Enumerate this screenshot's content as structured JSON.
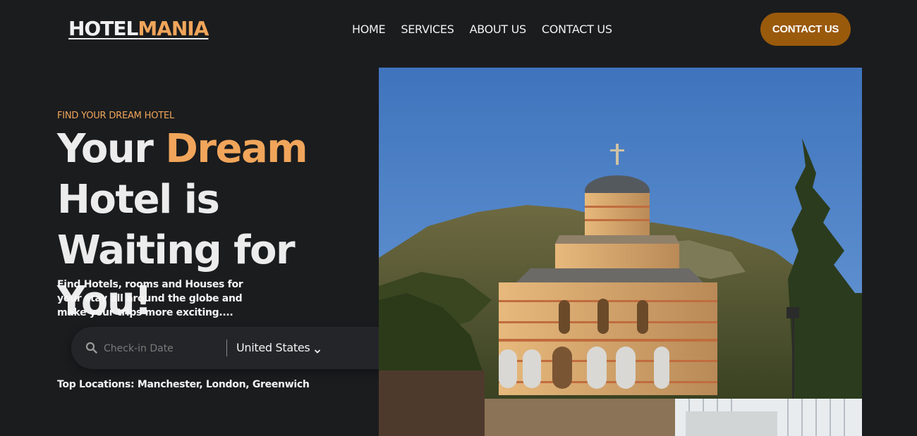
{
  "brand": {
    "part1": "HOTEL",
    "part2": "MANIA"
  },
  "nav": {
    "items": [
      "HOME",
      "SERVICES",
      "ABOUT US",
      "CONTACT US"
    ]
  },
  "header": {
    "cta_label": "CONTACT US"
  },
  "hero": {
    "eyebrow": "FIND YOUR DREAM HOTEL",
    "headline_part1": "Your ",
    "headline_accent": "Dream",
    "headline_part2": "Hotel is Waiting for You!",
    "description": "Find Hotels, rooms and Houses for your stay all around the globe and make your trips more exciting....",
    "top_locations": "Top Locations: Manchester, London, Greenwich"
  },
  "search": {
    "date_placeholder": "Check-in Date",
    "date_value": "",
    "country_selected": "United States"
  },
  "icons": [
    "search-icon",
    "chevron-down-icon",
    "send-icon"
  ],
  "colors": {
    "background": "#1b1c1e",
    "accent": "#f0a55a",
    "button": "#9a5a0c"
  }
}
